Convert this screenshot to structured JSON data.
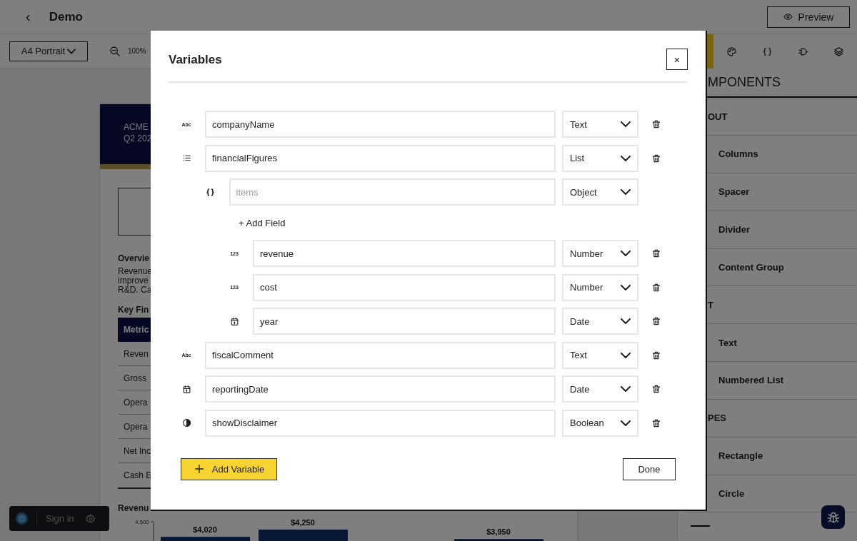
{
  "app": {
    "back": "‹",
    "title": "Demo",
    "preview": "Preview"
  },
  "toolbar": {
    "page_size": "A4 Portrait",
    "zoom": "100%"
  },
  "document": {
    "header_lines": [
      "ACME",
      "Q2 202"
    ],
    "overview_title": "Overvie",
    "overview_lines": [
      "Revenue",
      "improve",
      "R&D. Ca"
    ],
    "table_title": "Key Fin",
    "table_header": "Metric",
    "table_rows": [
      "Reven",
      "Gross",
      "Opera",
      "Opera",
      "Net Inc",
      "Cash E"
    ],
    "chart_title": "Revenu",
    "chart": {
      "axis_tick": "4,500",
      "bar_labels": [
        "$4,020",
        "$4,250",
        "$3,950"
      ]
    }
  },
  "sign_in": {
    "label": "Sign in"
  },
  "panel": {
    "tabs": [
      {
        "selected": true
      },
      {
        "selected": false
      },
      {
        "selected": false
      },
      {
        "selected": false
      },
      {
        "selected": false
      }
    ],
    "title": "MPONENTS",
    "sections": [
      {
        "title": "OUT",
        "items": [
          "Columns",
          "Spacer",
          "Divider",
          "Content Group"
        ]
      },
      {
        "title": "T",
        "items": [
          "Text",
          "Numbered List"
        ]
      },
      {
        "title": "PES",
        "items": [
          "Rectangle",
          "Circle"
        ]
      }
    ]
  },
  "modal": {
    "title": "Variables",
    "close": "×",
    "variables": [
      {
        "kind": "text",
        "badge": "Abc",
        "name": "companyName",
        "type": "Text",
        "deletable": true
      },
      {
        "kind": "list",
        "name": "financialFigures",
        "type": "List",
        "deletable": true,
        "children": [
          {
            "kind": "object",
            "placeholder": "items",
            "type": "Object",
            "deletable": false,
            "add_field": "+ Add Field",
            "children": [
              {
                "kind": "number",
                "badge": "123",
                "name": "revenue",
                "type": "Number",
                "deletable": true
              },
              {
                "kind": "number",
                "badge": "123",
                "name": "cost",
                "type": "Number",
                "deletable": true
              },
              {
                "kind": "date",
                "name": "year",
                "type": "Date",
                "deletable": true
              }
            ]
          }
        ]
      },
      {
        "kind": "text",
        "badge": "Abc",
        "name": "fiscalComment",
        "type": "Text",
        "deletable": true
      },
      {
        "kind": "date",
        "name": "reportingDate",
        "type": "Date",
        "deletable": true
      },
      {
        "kind": "boolean",
        "name": "showDisclaimer",
        "type": "Boolean",
        "deletable": true
      }
    ],
    "add_variable": "Add Variable",
    "done": "Done"
  }
}
